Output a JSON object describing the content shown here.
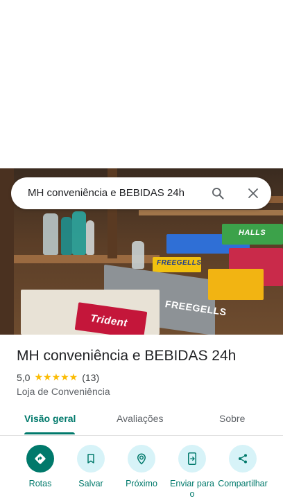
{
  "search": {
    "query": "MH conveniência e BEBIDAS 24h"
  },
  "hero": {
    "labels": [
      "FREEGELLS",
      "FREEGELLS",
      "HALLS",
      "Trident"
    ]
  },
  "place": {
    "name": "MH conveniência e BEBIDAS 24h",
    "rating": "5,0",
    "stars": "★★★★★",
    "rating_value": 5.0,
    "review_count": "(13)",
    "category": "Loja de Conveniência"
  },
  "tabs": [
    {
      "label": "Visão geral",
      "active": true
    },
    {
      "label": "Avaliações",
      "active": false
    },
    {
      "label": "Sobre",
      "active": false
    }
  ],
  "actions": [
    {
      "label": "Rotas",
      "icon": "directions-icon"
    },
    {
      "label": "Salvar",
      "icon": "bookmark-icon"
    },
    {
      "label": "Próximo",
      "icon": "nearby-icon"
    },
    {
      "label": "Enviar para o",
      "icon": "send-to-phone-icon"
    },
    {
      "label": "Compartilhar",
      "icon": "share-icon"
    }
  ],
  "colors": {
    "accent": "#00796b",
    "action_bg": "#d7f3f8",
    "star": "#fbbc04"
  }
}
